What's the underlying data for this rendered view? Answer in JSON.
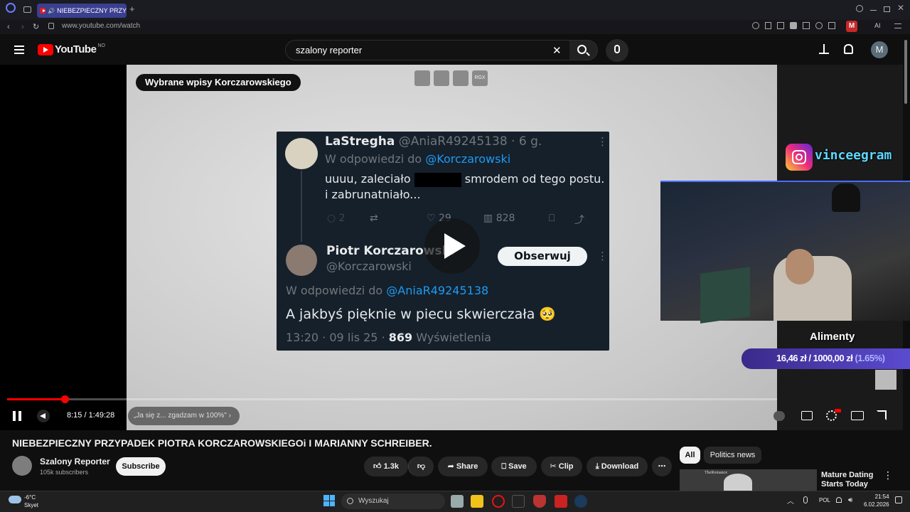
{
  "browser": {
    "tab_title": "NIEBEZPIECZNY PRZY",
    "url": "www.youtube.com/watch"
  },
  "youtube": {
    "logo_text": "YouTube",
    "logo_region": "NO",
    "search_value": "szalony reporter",
    "account_initial": "M"
  },
  "player": {
    "overlay_label": "Wybrane wpisy Korczarowskiego",
    "current_time": "8:15",
    "duration": "1:49:28",
    "time_display": "8:15 / 1:49:28",
    "progress_fraction": 0.075,
    "chapter": "„Ja się z... zgadzam w 100%\"",
    "ctl_label": "RGX"
  },
  "tweet": {
    "reply1_name": "LaStregha",
    "reply1_handle": "@AniaR49245138 · 6 g.",
    "reply1_to_label": "W odpowiedzi do",
    "reply1_to_handle": "@Korczarowski",
    "reply1_text_a": "uuuu, zaleciało",
    "reply1_text_b": "smrodem od tego postu.",
    "reply1_text_c": "i zabrunatniało...",
    "reply1_replies": "2",
    "reply1_likes": "29",
    "reply1_views": "828",
    "reply2_name": "Piotr Korczarowski",
    "reply2_handle": "@Korczarowski",
    "follow_label": "Obserwuj",
    "reply2_to_label": "W odpowiedzi do",
    "reply2_to_handle": "@AniaR49245138",
    "reply2_text": "A jakbyś pięknie w piecu skwierczała 🥺",
    "reply2_meta": "13:20 · 09 lis 25 ·",
    "reply2_views": "869",
    "reply2_views_label": "Wyświetlenia"
  },
  "stream_overlay": {
    "instagram_handle": "vinceegram",
    "goal_title": "Alimenty",
    "goal_amount": "16,46 zł",
    "goal_target": "1000,00 zł",
    "goal_percent": "(1.65%)",
    "goal_separator": "/"
  },
  "video": {
    "title": "NIEBEZPIECZNY PRZYPADEK PIOTRA KORCZAROWSKIEGOi I MARIANNY SCHREIBER.",
    "channel": "Szalony Reporter",
    "subscribers": "105k subscribers",
    "subscribe_label": "Subscribe",
    "likes": "1.3k",
    "share_label": "Share",
    "save_label": "Save",
    "clip_label": "Clip",
    "download_label": "Download"
  },
  "sidebar": {
    "chips": [
      "All",
      "Politics news"
    ],
    "ad_title": "Mature Dating Starts Today",
    "ad_thumb_text": "TheRomance"
  },
  "taskbar": {
    "weather_temp": "-6°C",
    "weather_desc": "Skyet",
    "search_placeholder": "Wyszukaj",
    "language": "POL",
    "time": "21:54",
    "date": "6.02.2026"
  },
  "colors": {
    "accent_red": "#ff0000",
    "tweet_bg": "#15202b",
    "twitter_blue": "#1d9bf0",
    "goal_bar": "#5b4bd0"
  }
}
